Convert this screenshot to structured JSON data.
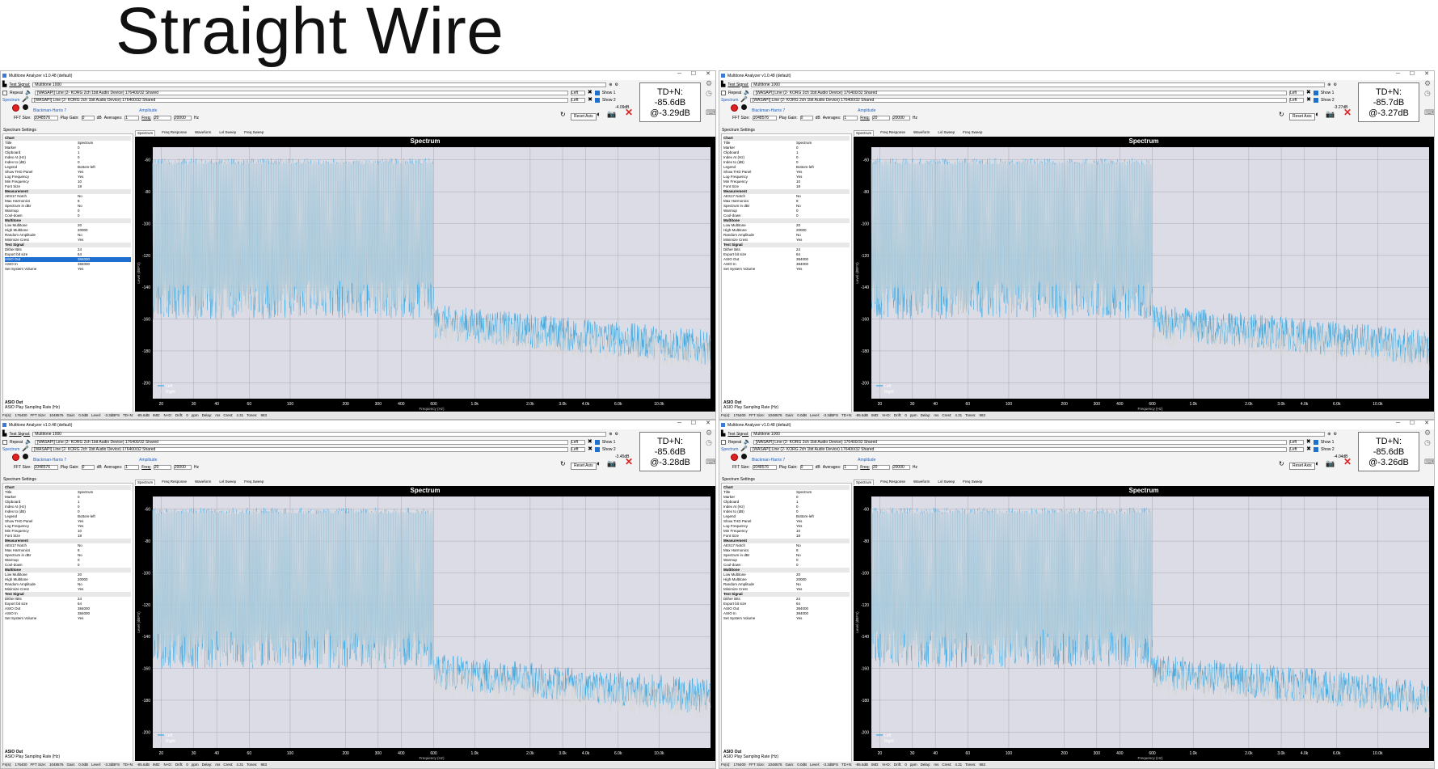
{
  "slide": {
    "title": "Straight Wire"
  },
  "app": {
    "title": "Multitone Analyzer v1.0.48 (default)"
  },
  "controls": {
    "test_signal_label": "Test Signal:",
    "test_signal_value": "Multitone 1000",
    "repeat_label": "Repeat",
    "spectrum_label": "Spectrum",
    "output_device": "[WASAPI] Line (2- KORG 2ch 1bit Audio Device) 176400/32 Shared",
    "input_device": "[WASAPI] Line (2- KORG 2ch 1bit Audio Device) 176400/32 Shared",
    "channel": "Left",
    "show1_label": "Show 1",
    "show2_label": "Show 2",
    "window_label": "Blackman-Harris 7",
    "amplitude_label": "Amplitude",
    "fft_size_label": "FFT Size:",
    "fft_size_value": "1048576",
    "play_gain_label": "Play Gain:",
    "play_gain_value": "0",
    "db_label": "dB",
    "averages_label": "Averages:",
    "averages_value": "1",
    "freq_label": "Freq:",
    "freq_from": "20",
    "freq_to": "20000",
    "hz_label": "Hz",
    "reset_axis_label": "Reset Axis"
  },
  "settings_panel": {
    "title": "Spectrum Settings",
    "rows": [
      {
        "k": "Chart",
        "v": "",
        "sec": true
      },
      {
        "k": "Title",
        "v": "Spectrum"
      },
      {
        "k": "Marker",
        "v": "0"
      },
      {
        "k": "Clipboard",
        "v": "1"
      },
      {
        "k": "Index At (Hz)",
        "v": "0"
      },
      {
        "k": "Index to (dB)",
        "v": "0"
      },
      {
        "k": "Legend",
        "v": "Bottom-left"
      },
      {
        "k": "Show THD Panel",
        "v": "Yes"
      },
      {
        "k": "Log Frequency",
        "v": "Yes"
      },
      {
        "k": "Min Frequency",
        "v": "10"
      },
      {
        "k": "Font Size",
        "v": "18"
      },
      {
        "k": "Measurement",
        "v": "",
        "sec": true
      },
      {
        "k": "AES17 Notch",
        "v": "No"
      },
      {
        "k": "Max Harmonics",
        "v": "8"
      },
      {
        "k": "Spectrum in dBr",
        "v": "No"
      },
      {
        "k": "Warmup",
        "v": "0"
      },
      {
        "k": "Cool-down",
        "v": "0"
      },
      {
        "k": "Multitone",
        "v": "",
        "sec": true
      },
      {
        "k": "Low Multitone",
        "v": "20"
      },
      {
        "k": "High Multitone",
        "v": "20000"
      },
      {
        "k": "Random Amplitude",
        "v": "No"
      },
      {
        "k": "Minimize Crest",
        "v": "Yes"
      },
      {
        "k": "Test Signal",
        "v": "",
        "sec": true
      },
      {
        "k": "Dither Bits",
        "v": "24"
      },
      {
        "k": "Export bit size",
        "v": "64"
      },
      {
        "k": "ASIO Out",
        "v": "384000"
      },
      {
        "k": "ASIO In",
        "v": "384000"
      },
      {
        "k": "Set System Volume",
        "v": "Yes"
      }
    ],
    "footer_title": "ASIO Out",
    "footer_desc": "ASIO Play Sampling Rate (Hz)"
  },
  "tabs": [
    "Spectrum",
    "Freq Response",
    "Waveform",
    "Lvl Sweep",
    "Freq Sweep"
  ],
  "status_fields": [
    "Fs(s):",
    "176400",
    "FFT Size:",
    "1048576",
    "Gain:",
    "0.0dB",
    "Level:",
    "-3.3dBFS",
    "TD+N:",
    "-85.6dB",
    "IMD:",
    "N+D:",
    "Drift:",
    "0",
    "ppm",
    "Delay:",
    "ms",
    "Crest:",
    "4.31",
    "Tones:",
    "983"
  ],
  "chart_common": {
    "title": "Spectrum",
    "ylabel": "Level (dBFS)",
    "xlabel": "Frequency (Hz)",
    "y_ticks": [
      "-60",
      "-80",
      "-100",
      "-120",
      "-140",
      "-160",
      "-180",
      "-200"
    ],
    "ylim": [
      -210,
      -52
    ],
    "x_ticks": [
      "20",
      "30",
      "40",
      "60",
      "100",
      "200",
      "300",
      "400",
      "600",
      "1.0k",
      "2.0k",
      "3.0k",
      "4.0k",
      "6.0k",
      "10.0k"
    ],
    "x_tick_values": [
      20,
      30,
      40,
      60,
      100,
      200,
      300,
      400,
      600,
      1000,
      2000,
      3000,
      4000,
      6000,
      10000
    ],
    "xlim": [
      18,
      19000
    ],
    "legend": [
      "Left",
      "Right"
    ],
    "series_colors": {
      "Left": "#3aa8e0",
      "Right": "#d8d8d8"
    },
    "plot_bg_shaded": "#dcdce6"
  },
  "windows": [
    {
      "td_label": "TD+N:",
      "td_value": "-85.6dB",
      "td_at": "@-3.29dB",
      "level_readout": "-4.09dB"
    },
    {
      "td_label": "TD+N:",
      "td_value": "-85.7dB",
      "td_at": "@-3.27dB",
      "level_readout": "-3.27dB"
    },
    {
      "td_label": "TD+N:",
      "td_value": "-85.6dB",
      "td_at": "@-3.28dB",
      "level_readout": "-3.45dB"
    },
    {
      "td_label": "TD+N:",
      "td_value": "-85.6dB",
      "td_at": "@-3.26dB",
      "level_readout": "-4.04dB"
    }
  ],
  "chart_data": [
    {
      "type": "line",
      "title": "Spectrum",
      "xlabel": "Frequency (Hz)",
      "ylabel": "Level (dBFS)",
      "x_scale": "log",
      "xlim": [
        18,
        19000
      ],
      "ylim": [
        -210,
        -52
      ],
      "legend": "bottom-left",
      "series": [
        {
          "name": "Left",
          "tone_peak_db": -59,
          "tone_range_hz": [
            20,
            600
          ],
          "noise_floor_db": [
            -145,
            -178
          ]
        },
        {
          "name": "Right",
          "tone_peak_db": -59,
          "tone_range_hz": [
            20,
            600
          ],
          "noise_floor_db": [
            -150,
            -182
          ]
        }
      ]
    },
    {
      "type": "line",
      "title": "Spectrum",
      "xlabel": "Frequency (Hz)",
      "ylabel": "Level (dBFS)",
      "x_scale": "log",
      "xlim": [
        18,
        19000
      ],
      "ylim": [
        -210,
        -52
      ],
      "legend": "bottom-left",
      "series": [
        {
          "name": "Left",
          "tone_peak_db": -59,
          "tone_range_hz": [
            20,
            600
          ],
          "noise_floor_db": [
            -145,
            -178
          ]
        },
        {
          "name": "Right",
          "tone_peak_db": -59,
          "tone_range_hz": [
            20,
            600
          ],
          "noise_floor_db": [
            -150,
            -182
          ]
        }
      ]
    },
    {
      "type": "line",
      "title": "Spectrum",
      "xlabel": "Frequency (Hz)",
      "ylabel": "Level (dBFS)",
      "x_scale": "log",
      "xlim": [
        18,
        19000
      ],
      "ylim": [
        -210,
        -52
      ],
      "legend": "bottom-left",
      "series": [
        {
          "name": "Left",
          "tone_peak_db": -59,
          "tone_range_hz": [
            20,
            600
          ],
          "noise_floor_db": [
            -145,
            -178
          ]
        },
        {
          "name": "Right",
          "tone_peak_db": -59,
          "tone_range_hz": [
            20,
            600
          ],
          "noise_floor_db": [
            -150,
            -182
          ]
        }
      ]
    },
    {
      "type": "line",
      "title": "Spectrum",
      "xlabel": "Frequency (Hz)",
      "ylabel": "Level (dBFS)",
      "x_scale": "log",
      "xlim": [
        18,
        19000
      ],
      "ylim": [
        -210,
        -52
      ],
      "legend": "bottom-left",
      "series": [
        {
          "name": "Left",
          "tone_peak_db": -59,
          "tone_range_hz": [
            20,
            600
          ],
          "noise_floor_db": [
            -145,
            -178
          ]
        },
        {
          "name": "Right",
          "tone_peak_db": -59,
          "tone_range_hz": [
            20,
            600
          ],
          "noise_floor_db": [
            -150,
            -182
          ]
        }
      ]
    }
  ]
}
